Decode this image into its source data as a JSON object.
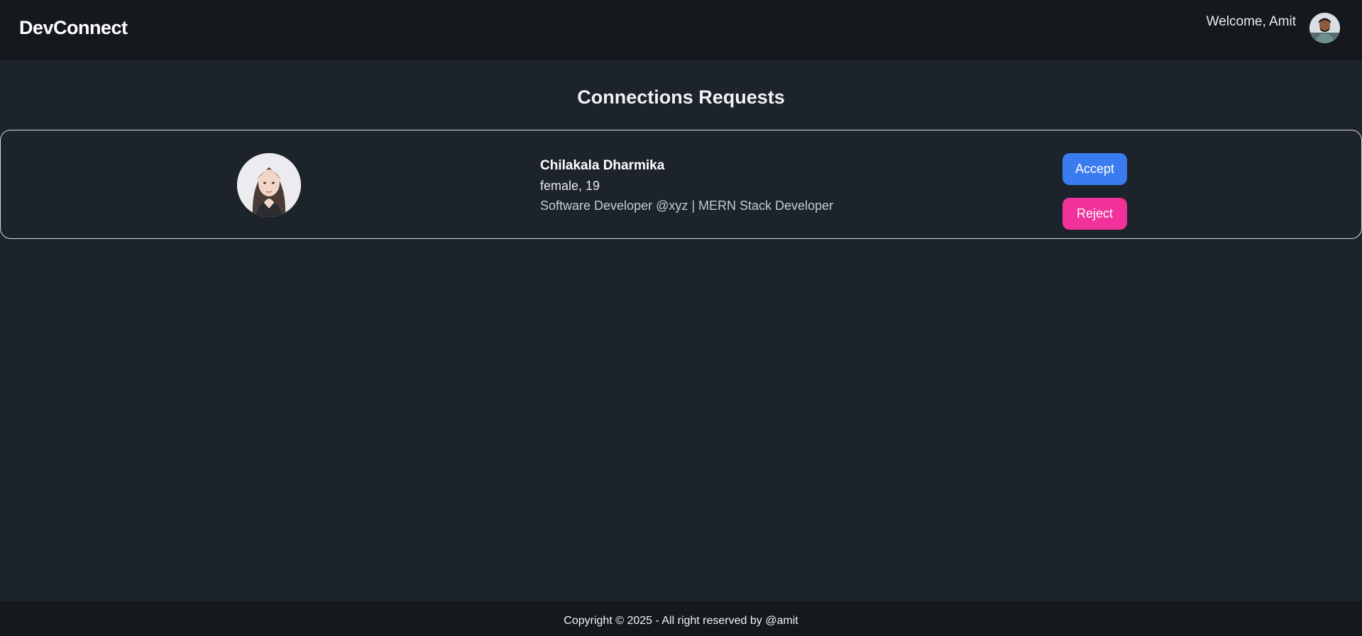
{
  "navbar": {
    "brand": "DevConnect",
    "welcome_text": "Welcome, Amit",
    "avatar_icon": "user-avatar-photo"
  },
  "main": {
    "title": "Connections Requests",
    "requests": [
      {
        "name": "Chilakala Dharmika",
        "meta": "female, 19",
        "about": "Software Developer @xyz | MERN Stack Developer",
        "avatar_icon": "profile-photo",
        "accept_label": "Accept",
        "reject_label": "Reject"
      }
    ]
  },
  "footer": {
    "text": "Copyright © 2025 - All right reserved by @amit"
  },
  "colors": {
    "page_bg": "#1d232a",
    "nav_bg": "#15191e",
    "accept": "#3a7cf0",
    "reject": "#f0329a"
  }
}
